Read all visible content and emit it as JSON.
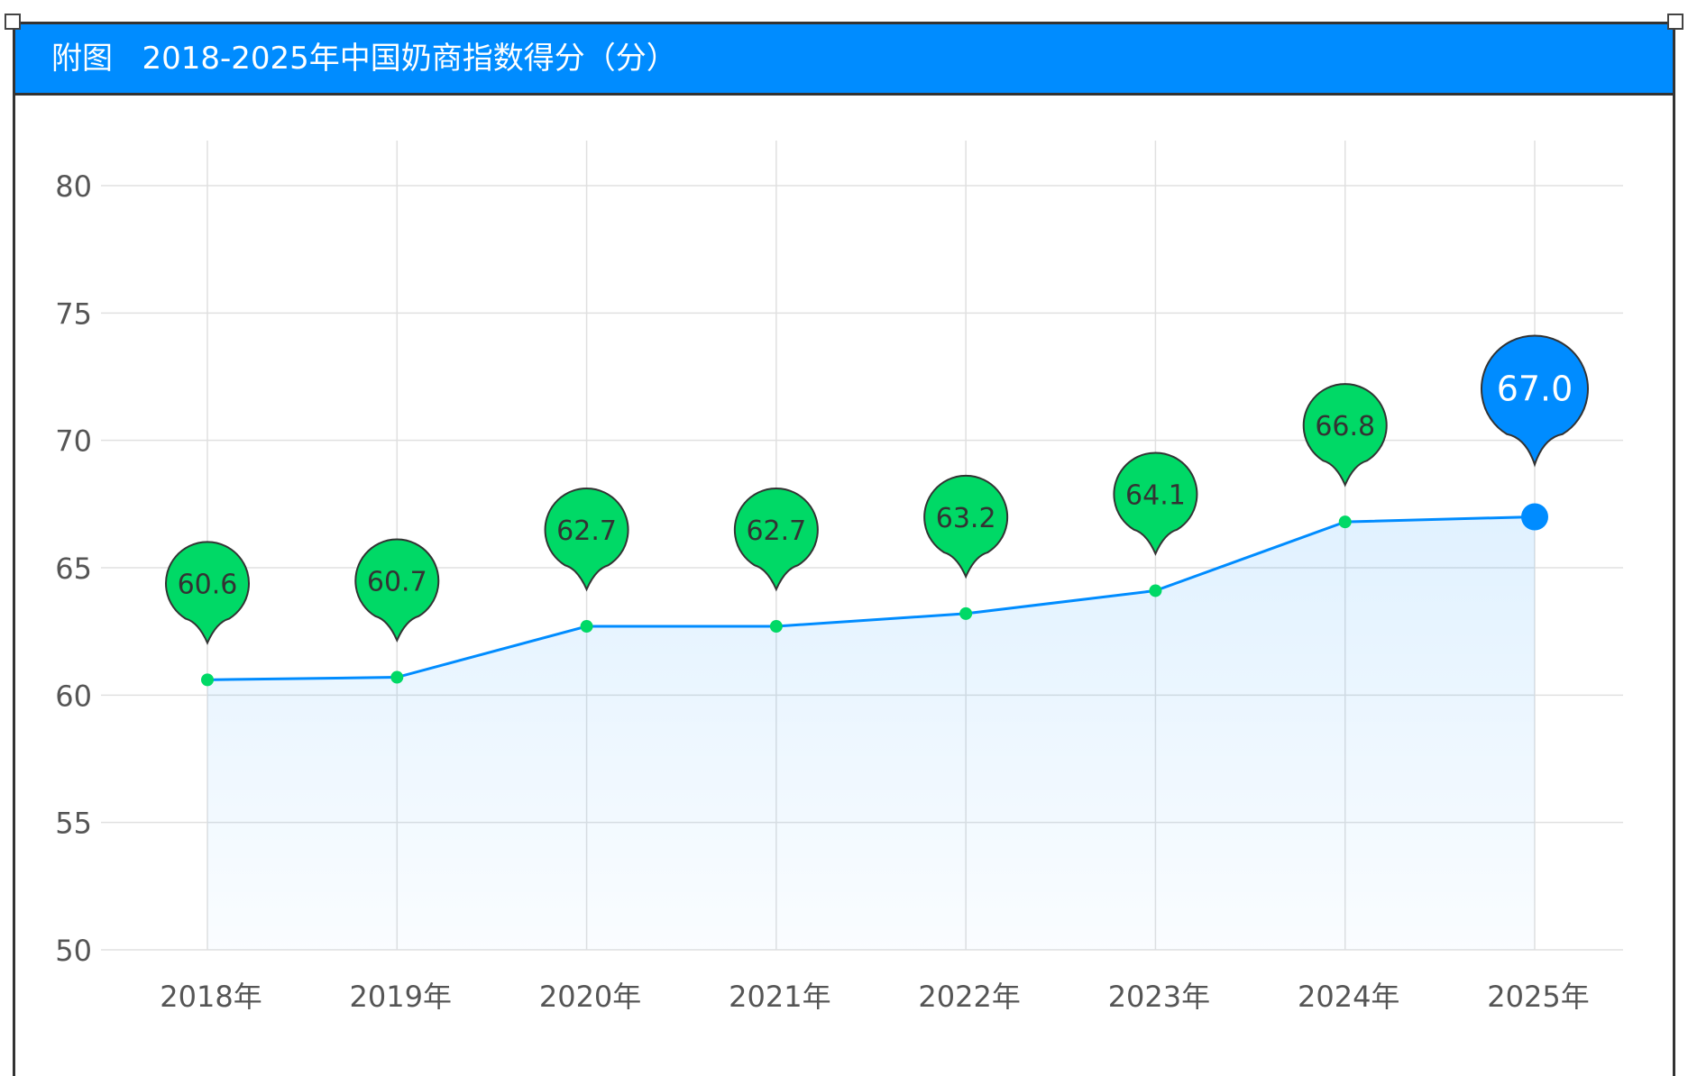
{
  "header": {
    "prefix": "附图",
    "title": "2018-2025年中国奶商指数得分（分）"
  },
  "colors": {
    "accent": "#008cff",
    "marker": "#00d966",
    "line": "#008cff"
  },
  "chart_data": {
    "type": "line",
    "title": "2018-2025年中国奶商指数得分（分）",
    "categories": [
      "2018年",
      "2019年",
      "2020年",
      "2021年",
      "2022年",
      "2023年",
      "2024年",
      "2025年"
    ],
    "values": [
      60.6,
      60.7,
      62.7,
      62.7,
      63.2,
      64.1,
      66.8,
      67.0
    ],
    "data_labels": [
      "60.6",
      "60.7",
      "62.7",
      "62.7",
      "63.2",
      "64.1",
      "66.8",
      "67.0"
    ],
    "ylim": [
      50,
      80
    ],
    "yticks": [
      50,
      55,
      60,
      65,
      70,
      75,
      80
    ],
    "grid": true,
    "area_fill": true,
    "highlight_last": true
  }
}
